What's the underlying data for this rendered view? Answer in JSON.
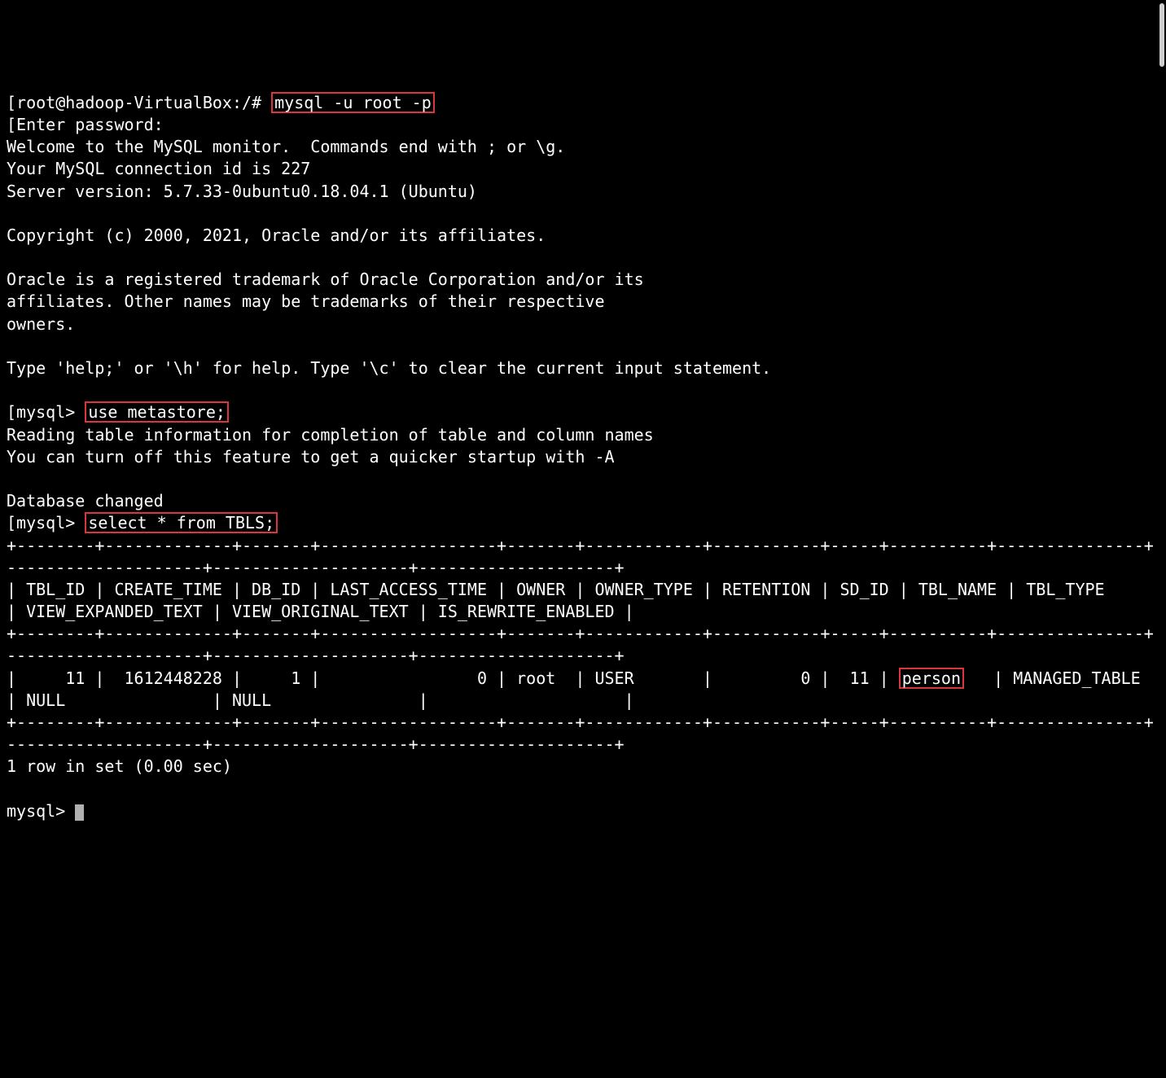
{
  "shell_prompt_prefix": "[root@hadoop-VirtualBox:/# ",
  "shell_cmd": "mysql -u root -p",
  "welcome": [
    "[Enter password:",
    "Welcome to the MySQL monitor.  Commands end with ; or \\g.",
    "Your MySQL connection id is 227",
    "Server version: 5.7.33-0ubuntu0.18.04.1 (Ubuntu)",
    "",
    "Copyright (c) 2000, 2021, Oracle and/or its affiliates.",
    "",
    "Oracle is a registered trademark of Oracle Corporation and/or its",
    "affiliates. Other names may be trademarks of their respective",
    "owners.",
    "",
    "Type 'help;' or '\\h' for help. Type '\\c' to clear the current input statement.",
    ""
  ],
  "mysql_prompt": "[mysql> ",
  "use_cmd": "use metastore;",
  "use_response": [
    "Reading table information for completion of table and column names",
    "You can turn off this feature to get a quicker startup with -A",
    "",
    "Database changed"
  ],
  "select_cmd": "select * from TBLS;",
  "table": {
    "sep": "+--------+-------------+-------+------------------+-------+------------+-----------+-----+----------+---------------+--------------------+--------------------+--------------------+",
    "header_wrapped": "| TBL_ID | CREATE_TIME | DB_ID | LAST_ACCESS_TIME | OWNER | OWNER_TYPE | RETENTION | SD_ID | TBL_NAME | TBL_TYPE      | VIEW_EXPANDED_TEXT | VIEW_ORIGINAL_TEXT | IS_REWRITE_ENABLED |",
    "row_pre": "|     11 |  1612448228 |     1 |                0 | root  | USER       |         0 |  11 | ",
    "row_person": "person",
    "row_post": "   | MANAGED_TABLE | NULL               | NULL               |                    |",
    "footer": "1 row in set (0.00 sec)"
  },
  "final_prompt": "mysql> "
}
